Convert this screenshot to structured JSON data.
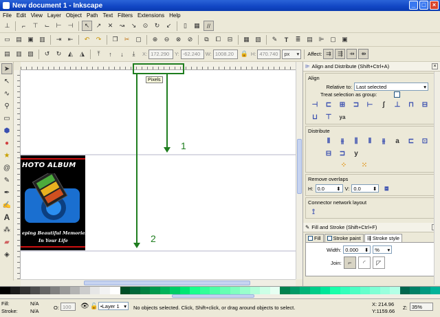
{
  "window": {
    "title": "New document 1 - Inkscape"
  },
  "menu": [
    "File",
    "Edit",
    "View",
    "Layer",
    "Object",
    "Path",
    "Text",
    "Filters",
    "Extensions",
    "Help"
  ],
  "toolbar3": {
    "x_label": "X:",
    "x_value": "172.290",
    "y_label": "Y:",
    "y_value": "-62.240",
    "w_label": "W:",
    "w_value": "1008.20",
    "h_label": "H:",
    "h_value": "470.740",
    "unit": "px",
    "affect_label": "Affect:"
  },
  "canvas": {
    "tooltip": "Pixels",
    "annotation_1": "1",
    "annotation_2": "2",
    "art_title": "HOTO ALBUM",
    "art_caption_1": "eping Beautiful Memories",
    "art_caption_2": "In Your Life"
  },
  "align_panel": {
    "header": "Align and Distribute (Shift+Ctrl+A)",
    "align_title": "Align",
    "relative_label": "Relative to:",
    "relative_value": "Last selected",
    "group_label": "Treat selection as group:",
    "distribute_title": "Distribute",
    "overlap_title": "Remove overlaps",
    "h_label": "H:",
    "h_value": "0.0",
    "v_label": "V:",
    "v_value": "0.0",
    "connector_title": "Connector network layout"
  },
  "fill_panel": {
    "header": "Fill and Stroke (Shift+Ctrl+F)",
    "tabs": [
      "Fill",
      "Stroke paint",
      "Stroke style"
    ],
    "width_label": "Width:",
    "width_value": "0.000",
    "width_unit": "%",
    "join_label": "Join:"
  },
  "status": {
    "fill_label": "Fill:",
    "fill_value": "N/A",
    "stroke_label": "Stroke:",
    "stroke_value": "N/A",
    "opacity_label": "O:",
    "opacity_value": "100",
    "layer": "•Layer 1",
    "message": "No objects selected. Click, Shift+click, or drag around objects to select.",
    "x_coord": "X: 214.96",
    "y_coord": "Y:1159.66",
    "zoom_label": "Z:",
    "zoom_value": "35%"
  },
  "palette_colors": [
    "#000000",
    "#1a1a1a",
    "#333333",
    "#4d4d4d",
    "#666666",
    "#808080",
    "#999999",
    "#b3b3b3",
    "#cccccc",
    "#e6e6e6",
    "#f2f2f2",
    "#ffffff",
    "#004d26",
    "#00663a",
    "#008040",
    "#00994d",
    "#00b35a",
    "#00cc66",
    "#00e673",
    "#1aff8c",
    "#33ff99",
    "#4dffa6",
    "#66ffb3",
    "#80ffbf",
    "#99ffcc",
    "#b3ffd9",
    "#ccffe6",
    "#e6fff2",
    "#00804d",
    "#009966",
    "#00b377",
    "#00cc88",
    "#00e699",
    "#1affaa",
    "#33ffbb",
    "#4dffc4",
    "#66ffcc",
    "#80ffd5",
    "#99ffdd",
    "#b3ffe6",
    "#00664d",
    "#008066",
    "#009980",
    "#00b399"
  ],
  "colors": {
    "annotation_green": "#1e7d1e",
    "art_blue": "#1a6fd0",
    "title_blue": "#0a3bb0"
  }
}
